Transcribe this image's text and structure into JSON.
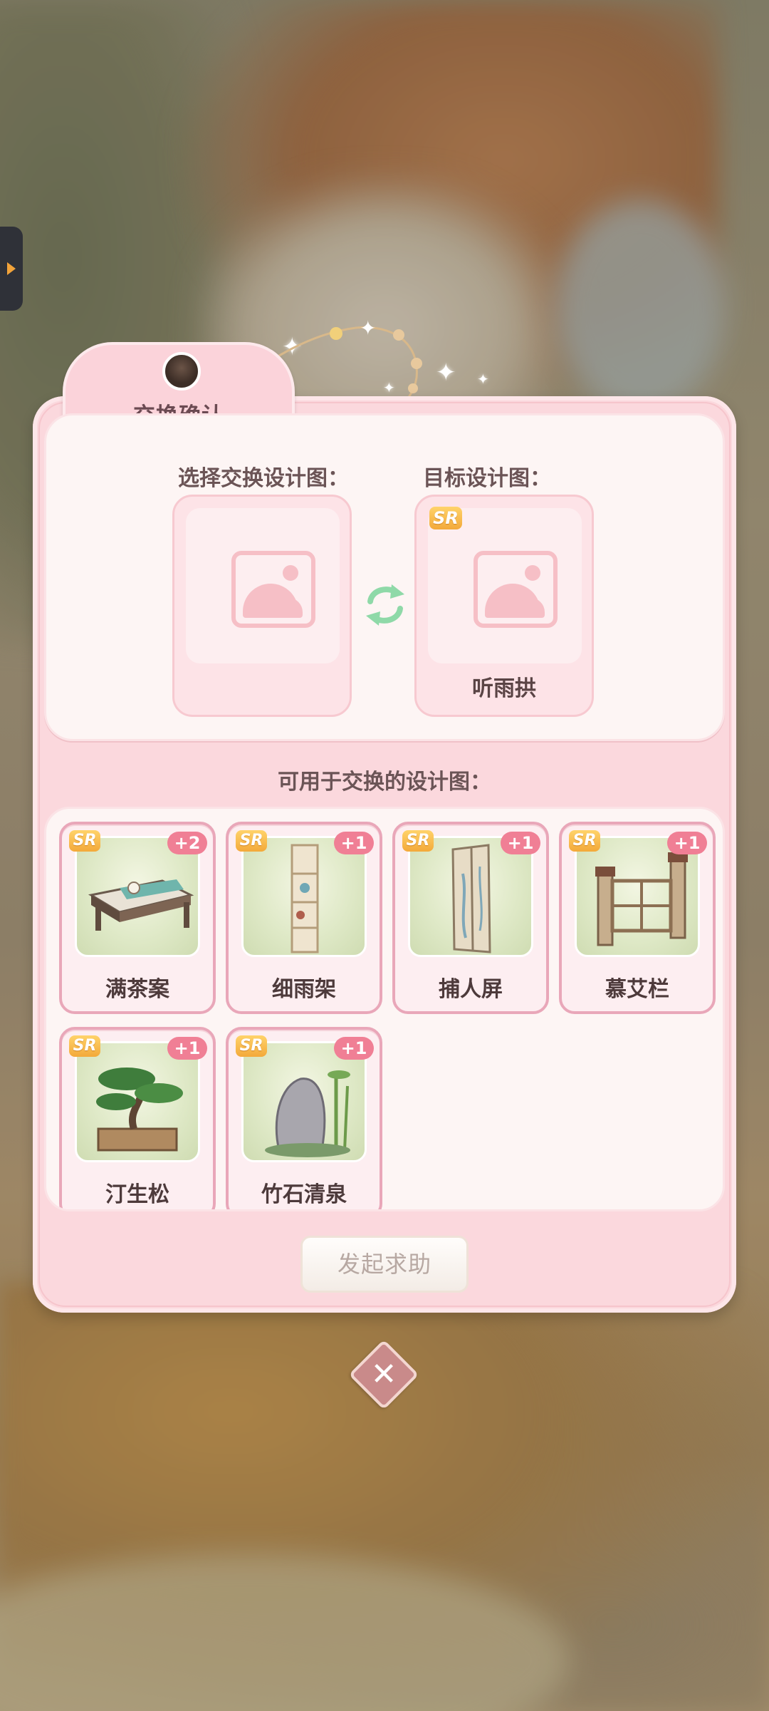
{
  "dialog": {
    "title": "交换确认",
    "select_label": "选择交换设计图：",
    "target_label": "目标设计图：",
    "target_item": {
      "rarity": "SR",
      "name": "听雨拱"
    },
    "available_label": "可用于交换的设计图：",
    "items": [
      {
        "name": "满茶案",
        "rarity": "SR",
        "count": "+2"
      },
      {
        "name": "细雨架",
        "rarity": "SR",
        "count": "+1"
      },
      {
        "name": "捕人屏",
        "rarity": "SR",
        "count": "+1"
      },
      {
        "name": "慕艾栏",
        "rarity": "SR",
        "count": "+1"
      },
      {
        "name": "汀生松",
        "rarity": "SR",
        "count": "+1"
      },
      {
        "name": "竹石清泉",
        "rarity": "SR",
        "count": "+1"
      }
    ],
    "help_button": "发起求助",
    "close_icon": "close-icon"
  },
  "colors": {
    "panel": "#fbd8dd",
    "count_badge": "#f07f95",
    "sr_badge": "#f3a93a"
  }
}
